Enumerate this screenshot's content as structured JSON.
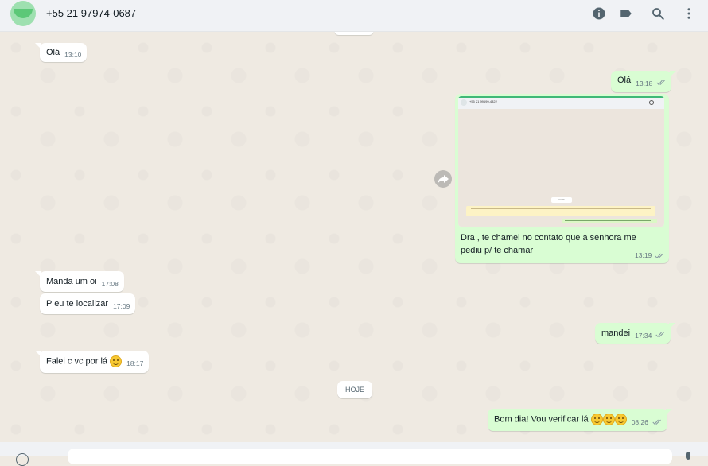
{
  "header": {
    "contact_name": "+55 21 97974-0687",
    "icons": [
      "info-icon",
      "label-icon",
      "search-icon",
      "menu-icon"
    ]
  },
  "messages": [
    {
      "dir": "in",
      "text": "Olá",
      "time": "13:10"
    },
    {
      "dir": "out",
      "text": "Olá",
      "time": "13:18"
    },
    {
      "dir": "out",
      "type": "image",
      "caption": "Dra , te chamei no contato que a senhora me pediu p/ te chamar",
      "time": "13:19",
      "thumbnail": {
        "header_text": "+55 21 99699-4322",
        "date_chip": "HOJE"
      }
    },
    {
      "dir": "in",
      "text": "Manda um oi",
      "time": "17:08"
    },
    {
      "dir": "in",
      "text": "P eu te localizar",
      "time": "17:09"
    },
    {
      "dir": "out",
      "text": "mandei",
      "time": "17:34"
    },
    {
      "dir": "in",
      "text": "Falei c vc por lá",
      "emoji_count": 1,
      "time": "18:17"
    },
    {
      "dir": "out",
      "text": "Bom dia! Vou verificar lá",
      "emoji_count": 3,
      "time": "08:26"
    }
  ],
  "date_divider": "HOJE",
  "colors": {
    "incoming_bubble": "#ffffff",
    "outgoing_bubble": "#d9fdd3",
    "chat_background": "#efeae2",
    "header_background": "#f0f2f5"
  }
}
